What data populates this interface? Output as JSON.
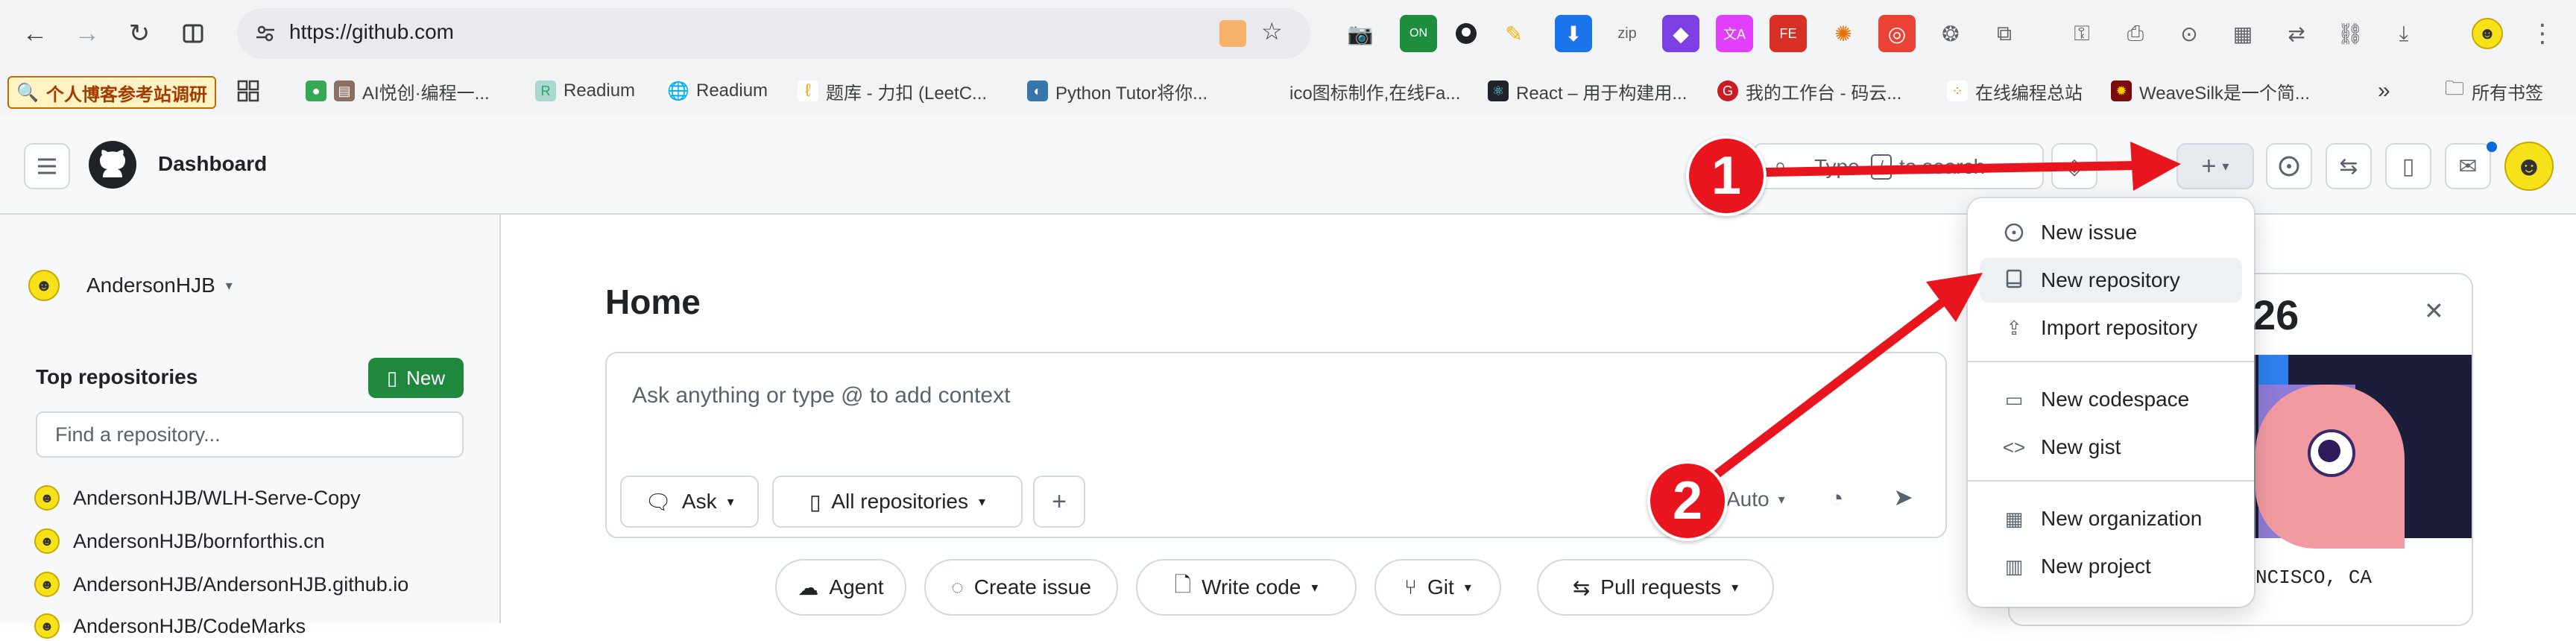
{
  "browser": {
    "url": "https://github.com",
    "bookmarks": [
      {
        "label": "个人博客参考站调研"
      },
      {
        "label": "AI悦创·编程一..."
      },
      {
        "label": "Readium"
      },
      {
        "label": "Readium"
      },
      {
        "label": "题库 - 力扣 (LeetC..."
      },
      {
        "label": "Python Tutor将你..."
      },
      {
        "label": "ico图标制作,在线Fa..."
      },
      {
        "label": "React – 用于构建用..."
      },
      {
        "label": "我的工作台 - 码云..."
      },
      {
        "label": "在线编程总站"
      },
      {
        "label": "WeaveSilk是一个简..."
      },
      {
        "label": "所有书签"
      }
    ],
    "more": "»"
  },
  "header": {
    "title": "Dashboard",
    "search_type": "Type",
    "search_key": "/",
    "search_rest": "to search"
  },
  "sidebar": {
    "user": "AndersonHJB",
    "top_repos_title": "Top repositories",
    "new_button": "New",
    "find_placeholder": "Find a repository...",
    "repos": [
      {
        "name": "AndersonHJB/WLH-Serve-Copy"
      },
      {
        "name": "AndersonHJB/bornforthis.cn"
      },
      {
        "name": "AndersonHJB/AndersonHJB.github.io"
      },
      {
        "name": "AndersonHJB/CodeMarks"
      }
    ]
  },
  "main": {
    "title": "Home",
    "prompt_placeholder": "Ask anything or type @ to add context",
    "ask": "Ask",
    "all_repos": "All repositories",
    "auto": "Auto",
    "actions": [
      "Agent",
      "Create issue",
      "Write code",
      "Git",
      "Pull requests"
    ]
  },
  "menu": {
    "items": [
      {
        "label": "New issue"
      },
      {
        "label": "New repository"
      },
      {
        "label": "Import repository"
      },
      {
        "label": "New codespace"
      },
      {
        "label": "New gist"
      },
      {
        "label": "New organization"
      },
      {
        "label": "New project"
      }
    ]
  },
  "card": {
    "year_fragment": "26",
    "location_fragment": "NCISCO, CA"
  },
  "annotations": {
    "marker1": "1",
    "marker2": "2",
    "arrow_color": "#e8151f"
  }
}
